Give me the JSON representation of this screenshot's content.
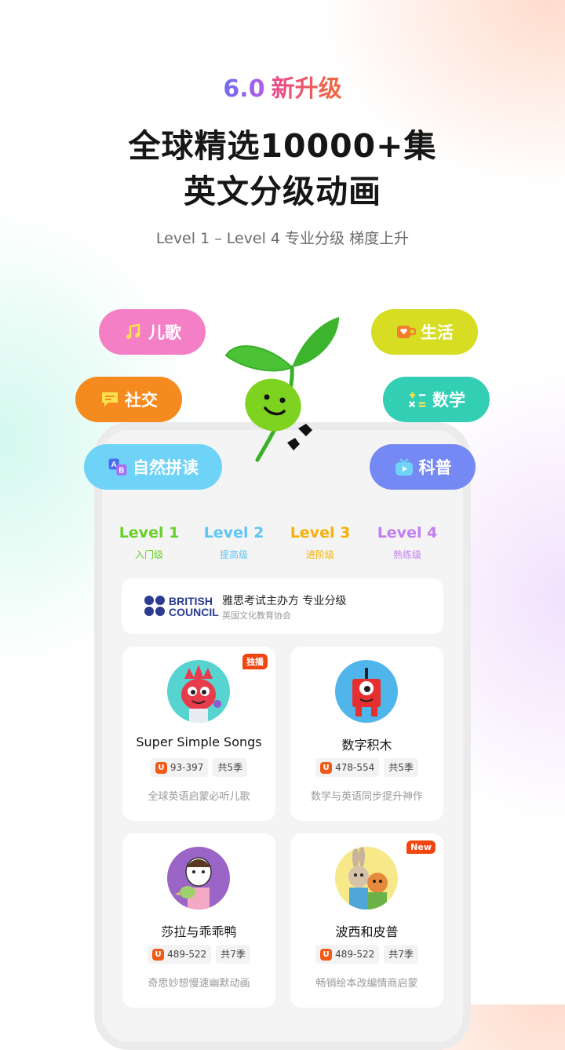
{
  "header": {
    "version_num": "6.0",
    "version_text": "新升级",
    "headline_1": "全球精选10000+集",
    "headline_2": "英文分级动画",
    "subtitle": "Level 1 – Level 4 专业分级 梯度上升"
  },
  "categories": [
    {
      "label": "儿歌",
      "icon": "music-note-icon",
      "color": "#f47fc6"
    },
    {
      "label": "生活",
      "icon": "cup-heart-icon",
      "color": "#d6dd22"
    },
    {
      "label": "社交",
      "icon": "chat-bubble-icon",
      "color": "#f58a1f"
    },
    {
      "label": "数学",
      "icon": "math-symbols-icon",
      "color": "#33cfb4"
    },
    {
      "label": "自然拼读",
      "icon": "ab-letters-icon",
      "color": "#6fd3f8"
    },
    {
      "label": "科普",
      "icon": "tv-play-icon",
      "color": "#7589f5"
    }
  ],
  "levels": [
    {
      "name": "Level 1",
      "sub": "入门级",
      "color": "#67d127"
    },
    {
      "name": "Level 2",
      "sub": "提高级",
      "color": "#5fc6f5"
    },
    {
      "name": "Level 3",
      "sub": "进阶级",
      "color": "#f5b10a"
    },
    {
      "name": "Level 4",
      "sub": "熟练级",
      "color": "#c27df0"
    }
  ],
  "british_council": {
    "logo_line1": "BRITISH",
    "logo_line2": "COUNCIL",
    "main": "雅思考试主办方 专业分级",
    "sub": "英国文化教育协会"
  },
  "cards": [
    {
      "title": "Super Simple Songs",
      "range": "93-397",
      "seasons": "共5季",
      "desc": "全球英语启蒙必听儿歌",
      "badge": "独播"
    },
    {
      "title": "数字积木",
      "range": "478-554",
      "seasons": "共5季",
      "desc": "数学与英语同步提升神作",
      "badge": ""
    },
    {
      "title": "莎拉与乖乖鸭",
      "range": "489-522",
      "seasons": "共7季",
      "desc": "奇思妙想慢速幽默动画",
      "badge": ""
    },
    {
      "title": "波西和皮普",
      "range": "489-522",
      "seasons": "共7季",
      "desc": "畅销绘本改编情商启蒙",
      "badge": "New"
    }
  ],
  "u_icon_letter": "U"
}
